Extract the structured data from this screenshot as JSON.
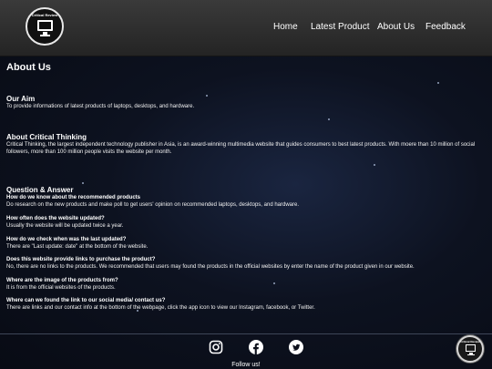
{
  "header": {
    "logo_text": "Critical Review",
    "nav": [
      "Home",
      "Latest Product",
      "About Us",
      "Feedback"
    ]
  },
  "main": {
    "page_title": "About Us",
    "aim": {
      "title": "Our Aim",
      "text": "To provide informations of latest products of laptops, desktops, and hardware."
    },
    "about": {
      "title": "About Critical Thinking",
      "text": "Critical Thinking, the largest independent technology publisher in Asia, is an award-winning multimedia website that guides consumers to best latest products. With moere than 10 million of social followers, more than 100 million people visits the website per month."
    },
    "qa": {
      "title": "Question & Answer",
      "items": [
        {
          "q": "How do we know about the recommended products",
          "a": "Do research on the new products and make poll to get users' opinion on recommended laptops, desktops, and hardware."
        },
        {
          "q": "How often does the website updated?",
          "a": "Usually the website will be updated twice a year."
        },
        {
          "q": "How do we check when was the last updated?",
          "a": "There are \"Last update: date\" at the bottom of the website."
        },
        {
          "q": "Does this website provide links to purchase the product?",
          "a": "No, there are no links to the products. We recommended that users may found the products in the official websites by enter the name of the product given in our website."
        },
        {
          "q": "Where are the image of the products from?",
          "a": "It is from the official websites of the products."
        },
        {
          "q": "Where can we found the link to our social media/ contact us?",
          "a": "There are links and our contact info at the bottom of the webpage, click the app icon to view our Instagram, facebook, or Twitter."
        }
      ]
    }
  },
  "footer": {
    "icons": [
      "instagram-icon",
      "facebook-icon",
      "twitter-icon"
    ],
    "follow_text": "Follow us!"
  }
}
